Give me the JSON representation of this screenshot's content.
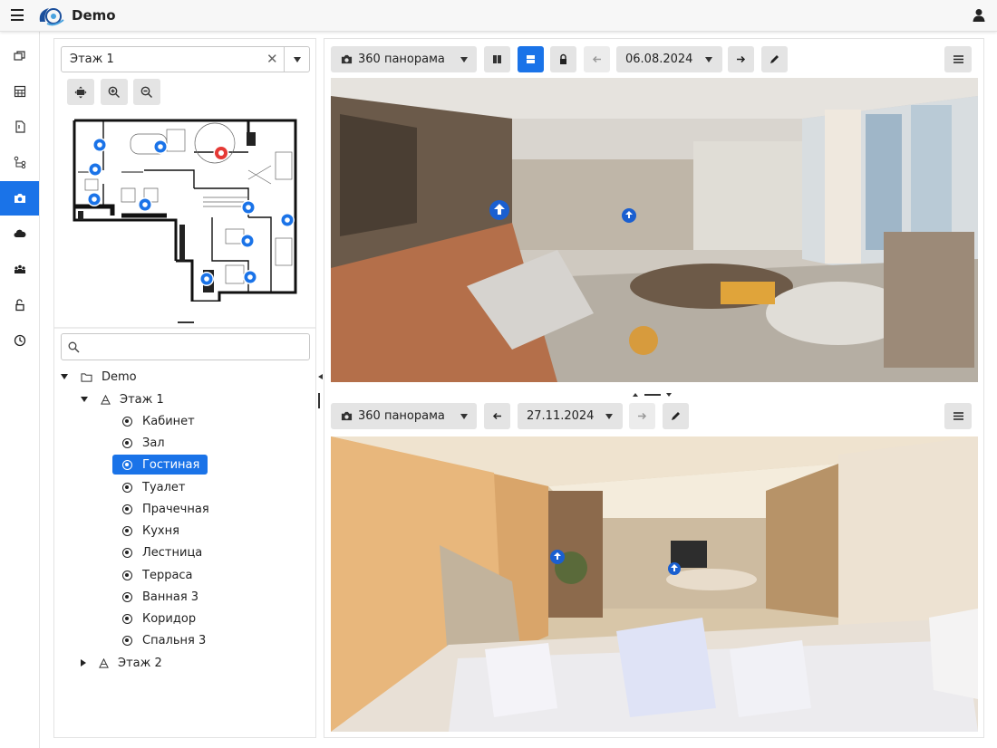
{
  "app": {
    "title": "Demo"
  },
  "rail": {
    "items": [
      {
        "icon": "layers-icon"
      },
      {
        "icon": "grid-icon"
      },
      {
        "icon": "document-icon"
      },
      {
        "icon": "hierarchy-icon"
      },
      {
        "icon": "camera-icon",
        "active": true
      },
      {
        "icon": "cloud-icon"
      },
      {
        "icon": "people-icon"
      },
      {
        "icon": "unlock-icon"
      },
      {
        "icon": "clock-icon"
      }
    ]
  },
  "left": {
    "floor_select": {
      "value": "Этаж 1"
    },
    "map_buttons": [
      "fit-icon",
      "zoom-in-icon",
      "zoom-out-icon"
    ],
    "search": {
      "placeholder": ""
    },
    "tree": {
      "root": "Demo",
      "floor1": "Этаж 1",
      "rooms": [
        "Кабинет",
        "Зал",
        "Гостиная",
        "Туалет",
        "Прачечная",
        "Кухня",
        "Лестница",
        "Терраса",
        "Ванная 3",
        "Коридор",
        "Спальня 3"
      ],
      "selected_room": "Гостиная",
      "floor2": "Этаж 2"
    }
  },
  "viewer_top": {
    "mode_label": "360 панорама",
    "date": "06.08.2024"
  },
  "viewer_bottom": {
    "mode_label": "360 панорама",
    "date": "27.11.2024"
  },
  "colors": {
    "accent": "#1a73e8",
    "marker_blue": "#1a73e8",
    "marker_red": "#e53935"
  }
}
